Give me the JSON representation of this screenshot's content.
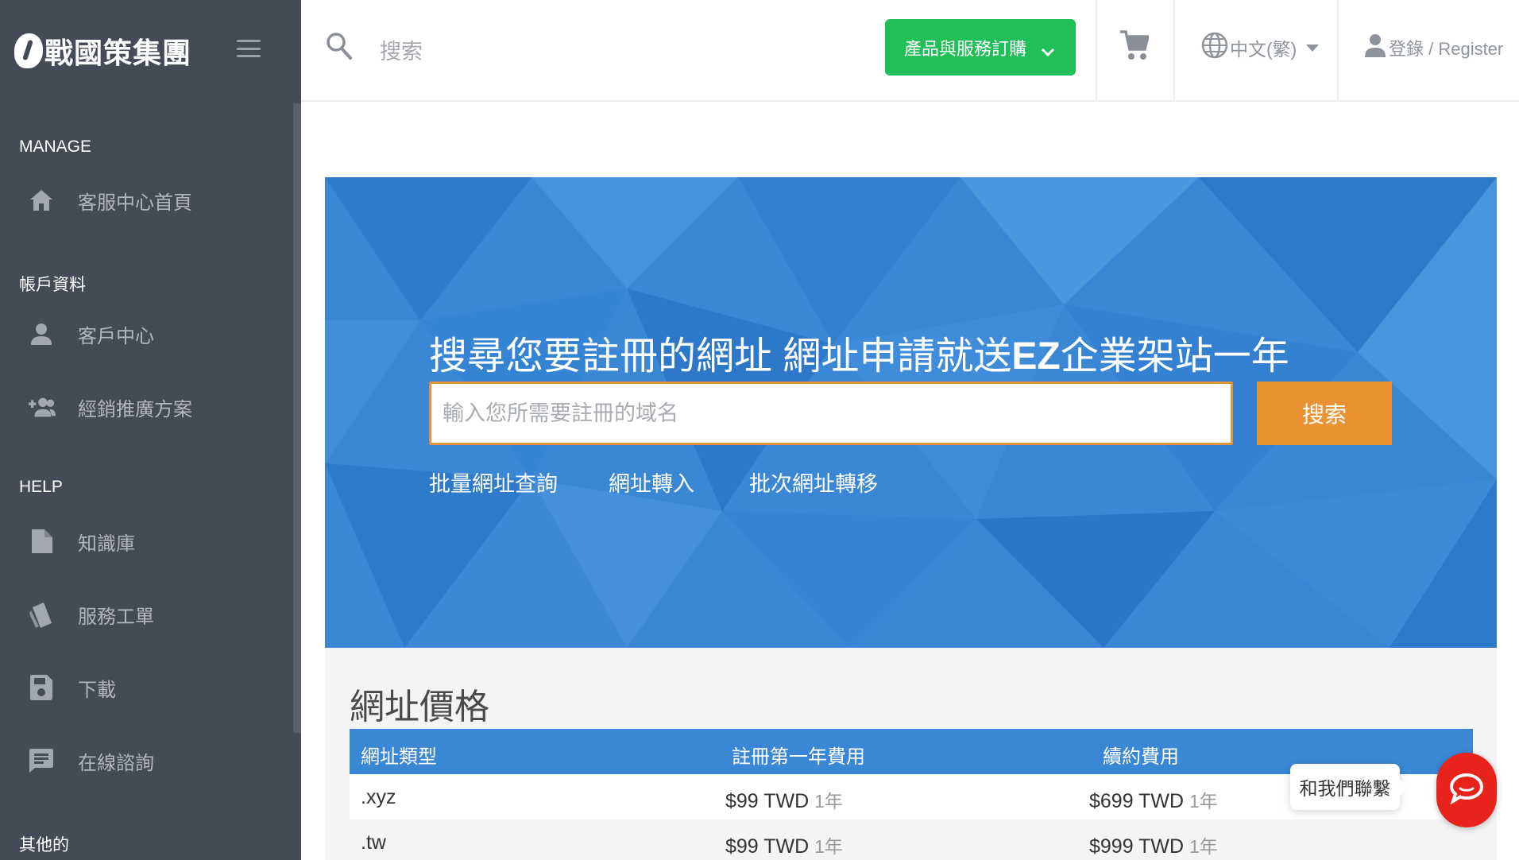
{
  "sidebar": {
    "logo_text": "戰國策集團",
    "sections": [
      {
        "title": "MANAGE",
        "items": [
          {
            "label": "客服中心首頁",
            "icon": "home-icon"
          }
        ]
      },
      {
        "title": "帳戶資料",
        "items": [
          {
            "label": "客戶中心",
            "icon": "user-icon"
          },
          {
            "label": "經銷推廣方案",
            "icon": "group-add-icon"
          }
        ]
      },
      {
        "title": "HELP",
        "items": [
          {
            "label": "知識庫",
            "icon": "document-icon"
          },
          {
            "label": "服務工單",
            "icon": "ticket-icon"
          },
          {
            "label": "下載",
            "icon": "save-icon"
          },
          {
            "label": "在線諮詢",
            "icon": "chat-icon"
          }
        ]
      },
      {
        "title": "其他的",
        "items": []
      }
    ]
  },
  "header": {
    "search_label": "搜索",
    "order_button": "產品與服務訂購",
    "language": "中文(繁)",
    "login": "登錄 / Register"
  },
  "hero": {
    "title_part1": "搜尋您要註冊的網址 網址申請就送",
    "title_bold": "EZ",
    "title_part2": "企業架站一年",
    "input_placeholder": "輸入您所需要註冊的域名",
    "search_button": "搜索",
    "links": [
      "批量網址查詢",
      "網址轉入",
      "批次網址轉移"
    ]
  },
  "pricing": {
    "title": "網址價格",
    "columns": [
      "網址類型",
      "註冊第一年費用",
      "續約費用"
    ],
    "rows": [
      {
        "type": ".xyz",
        "first_price": "$99 TWD",
        "first_unit": "1年",
        "renew_price": "$699 TWD",
        "renew_unit": "1年"
      },
      {
        "type": ".tw",
        "first_price": "$99 TWD",
        "first_unit": "1年",
        "renew_price": "$999 TWD",
        "renew_unit": "1年"
      }
    ]
  },
  "chat": {
    "label": "和我們聯繫"
  },
  "colors": {
    "sidebar_bg": "#454a57",
    "primary_blue": "#3a87d6",
    "order_green": "#21bf58",
    "search_orange": "#ea9232",
    "chat_red": "#e8231b"
  }
}
